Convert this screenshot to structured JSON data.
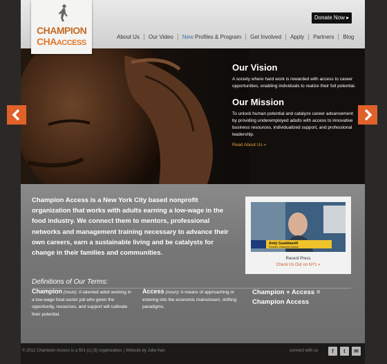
{
  "logo": {
    "line1_a": "CH",
    "line1_b": "AMPION",
    "line2_a": "CHA",
    "line2_b": "ACCESS"
  },
  "header": {
    "donate": "Donate Now ▸"
  },
  "nav": [
    {
      "label": "About Us"
    },
    {
      "label": "Our Video"
    },
    {
      "label_hl": "New",
      "label": " Profiles & Program"
    },
    {
      "label": "Get Involved"
    },
    {
      "label": "Apply"
    },
    {
      "label": "Partners"
    },
    {
      "label": "Blog"
    }
  ],
  "hero": {
    "vision_title": "Our Vision",
    "vision_text": "A society where hard work is rewarded with access to career opportunities, enabling individuals to realize their full potential.",
    "mission_title": "Our Mission",
    "mission_text": "To unlock human potential and catalyze career advancement by providing underemployed adults with access to innovative business resources, individualized support, and professional leadership.",
    "read_more": "Read About Us »"
  },
  "content": {
    "intro": "Champion Access is a New York City based nonprofit organization that works with adults earning a low-wage in the food industry. We connect them to mentors, professional networks and management training necessary to advance their own careers, earn a sustainable living and be catalysts for change in their families and communities.",
    "video": {
      "name_caption": "Andy Guaddaselli",
      "sub_caption": "Founder, Champion Access",
      "recent": "Recent Press",
      "checkout": "Check Us Out on NY1 »"
    },
    "defs_title": "Definitions of Our Terms:",
    "defs": [
      {
        "term": "Champion",
        "pos": " (noun):",
        "text": " A talented adult working in a low-wage food sector job who given the opportunity, resources, and support will cultivate their potential."
      },
      {
        "term": "Access",
        "pos": " (noun):",
        "text": " A means of approaching or entering into the economic mainstream, shifting paradigms."
      }
    ],
    "equation_line1": "Champion + Access =",
    "equation_line2": "Champion Access"
  },
  "footer": {
    "copyright": "© 2012 Champion Access is a 501 (c) (3) organization. | Website by Julia Han.",
    "connect": "connect with us",
    "social": [
      "facebook-icon",
      "twitter-icon",
      "mail-icon"
    ]
  },
  "colors": {
    "accent": "#e0612a",
    "brand_orange": "#e0792c",
    "link_orange": "#e8a23a"
  }
}
